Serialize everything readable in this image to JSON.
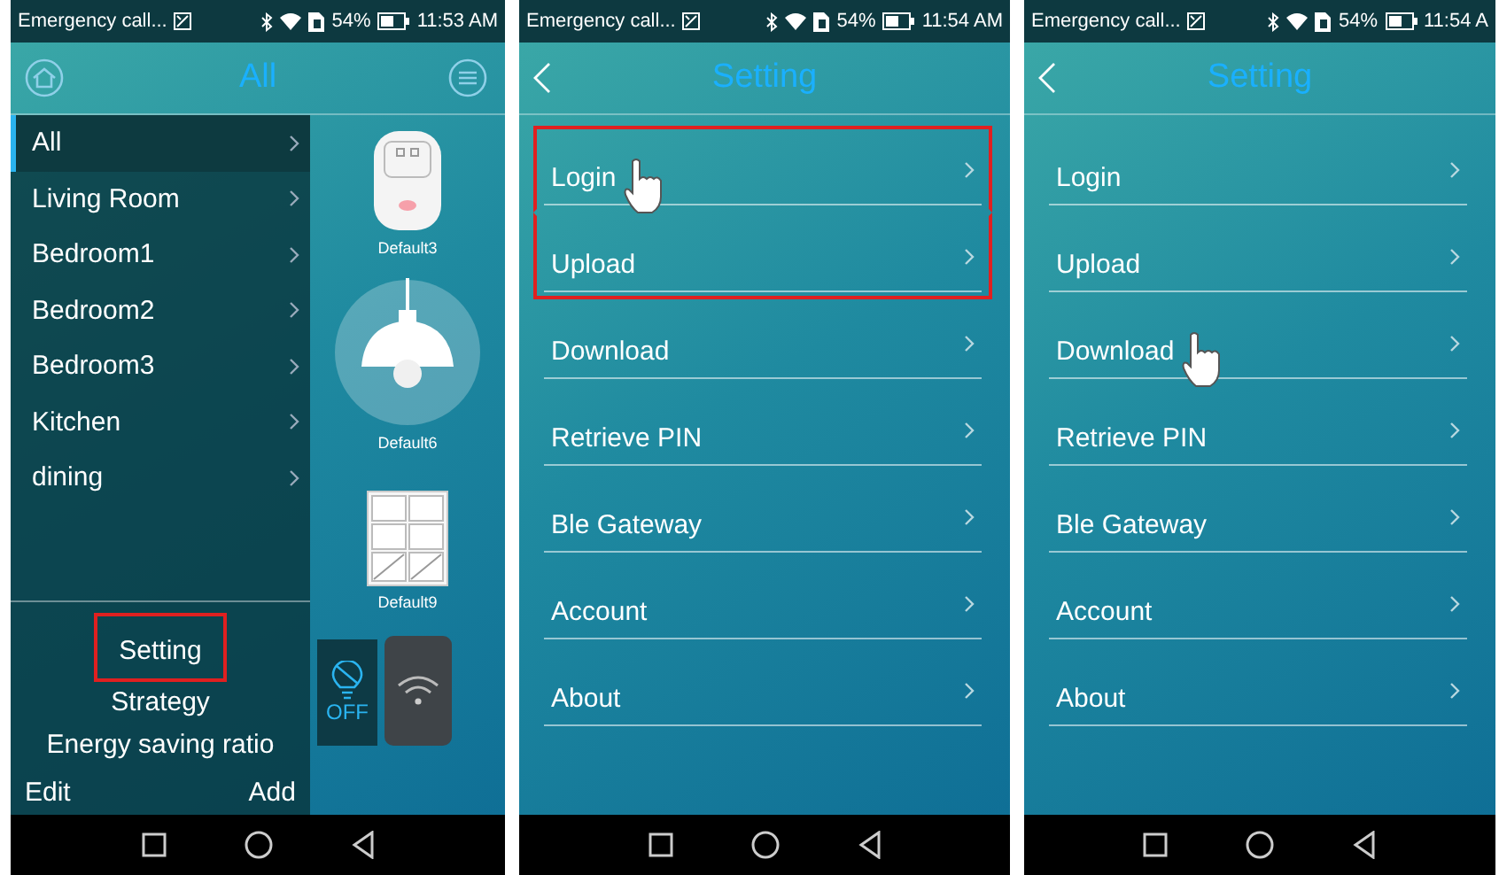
{
  "phones": [
    {
      "kind": "home",
      "status_bar": {
        "notice": "Emergency call...",
        "battery": "54%",
        "time": "11:53 AM"
      },
      "title": "All",
      "rooms": [
        {
          "label": "All",
          "selected": true
        },
        {
          "label": "Living Room",
          "selected": false
        },
        {
          "label": "Bedroom1",
          "selected": false
        },
        {
          "label": "Bedroom2",
          "selected": false
        },
        {
          "label": "Bedroom3",
          "selected": false
        },
        {
          "label": "Kitchen",
          "selected": false
        },
        {
          "label": "dining",
          "selected": false
        }
      ],
      "menu": [
        {
          "label": "Setting",
          "highlighted": true
        },
        {
          "label": "Strategy",
          "highlighted": false
        },
        {
          "label": "Energy saving ratio",
          "highlighted": false
        }
      ],
      "edit": "Edit",
      "add": "Add",
      "devices": [
        {
          "kind": "plug",
          "label": "Default3"
        },
        {
          "kind": "lamp",
          "label": "Default6"
        },
        {
          "kind": "switch",
          "label": "Default9"
        }
      ],
      "tiles": [
        {
          "kind": "bulb",
          "label": "OFF"
        },
        {
          "kind": "wifi"
        }
      ]
    },
    {
      "kind": "setting",
      "status_bar": {
        "notice": "Emergency call...",
        "battery": "54%",
        "time": "11:54 AM"
      },
      "title": "Setting",
      "items": [
        {
          "label": "Login",
          "highlighted": true,
          "pointer": true
        },
        {
          "label": "Upload",
          "highlighted": true,
          "pointer": false
        },
        {
          "label": "Download",
          "highlighted": false,
          "pointer": false
        },
        {
          "label": "Retrieve PIN",
          "highlighted": false,
          "pointer": false
        },
        {
          "label": "Ble Gateway",
          "highlighted": false,
          "pointer": false
        },
        {
          "label": "Account",
          "highlighted": false,
          "pointer": false
        },
        {
          "label": "About",
          "highlighted": false,
          "pointer": false
        }
      ]
    },
    {
      "kind": "setting",
      "status_bar": {
        "notice": "Emergency call...",
        "battery": "54%",
        "time": "11:54 A"
      },
      "title": "Setting",
      "items": [
        {
          "label": "Login",
          "highlighted": false,
          "pointer": false
        },
        {
          "label": "Upload",
          "highlighted": false,
          "pointer": false
        },
        {
          "label": "Download",
          "highlighted": false,
          "pointer": true
        },
        {
          "label": "Retrieve PIN",
          "highlighted": false,
          "pointer": false
        },
        {
          "label": "Ble Gateway",
          "highlighted": false,
          "pointer": false
        },
        {
          "label": "Account",
          "highlighted": false,
          "pointer": false
        },
        {
          "label": "About",
          "highlighted": false,
          "pointer": false
        }
      ]
    }
  ]
}
